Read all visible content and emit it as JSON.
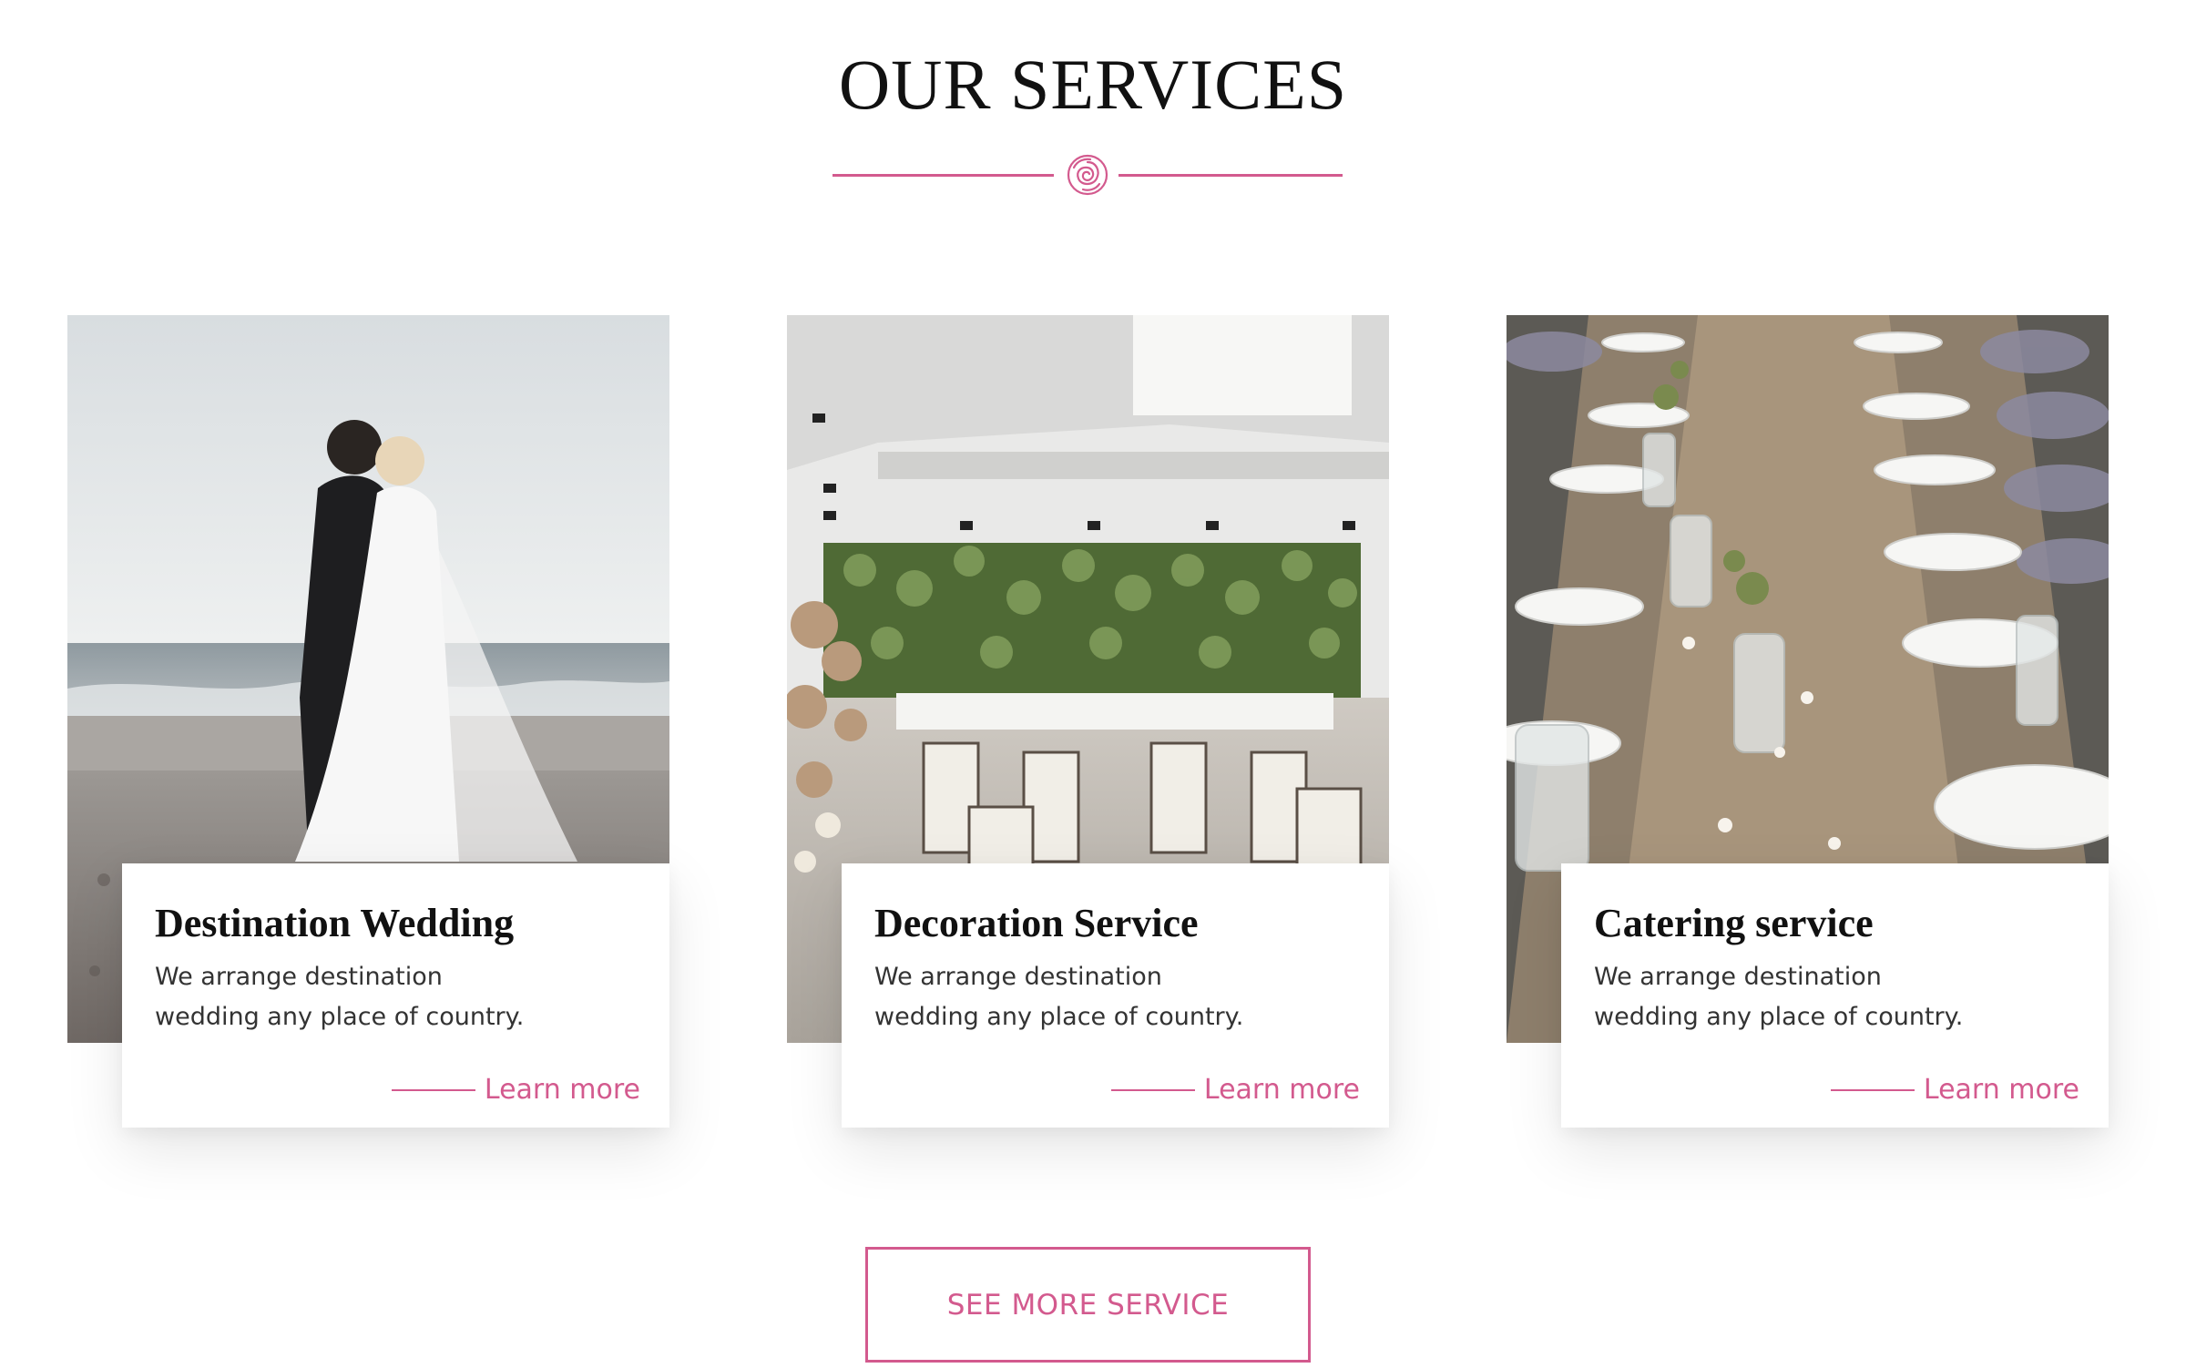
{
  "section": {
    "title": "OUR SERVICES"
  },
  "colors": {
    "accent": "#d35a8e",
    "heading": "#111111",
    "body_text": "#333333",
    "background": "#ffffff"
  },
  "services": [
    {
      "title": "Destination Wedding",
      "description": "We arrange destination wedding any place of country.",
      "link_label": "Learn more",
      "image_subject": "bride and groom on beach"
    },
    {
      "title": "Decoration Service",
      "description": "We arrange destination wedding any place of country.",
      "link_label": "Learn more",
      "image_subject": "banquet hall with green wall"
    },
    {
      "title": "Catering service",
      "description": "We arrange destination wedding any place of country.",
      "link_label": "Learn more",
      "image_subject": "rustic dining table setting"
    }
  ],
  "cta": {
    "label": "SEE MORE SERVICE"
  },
  "icons": {
    "divider": "rose-icon"
  }
}
